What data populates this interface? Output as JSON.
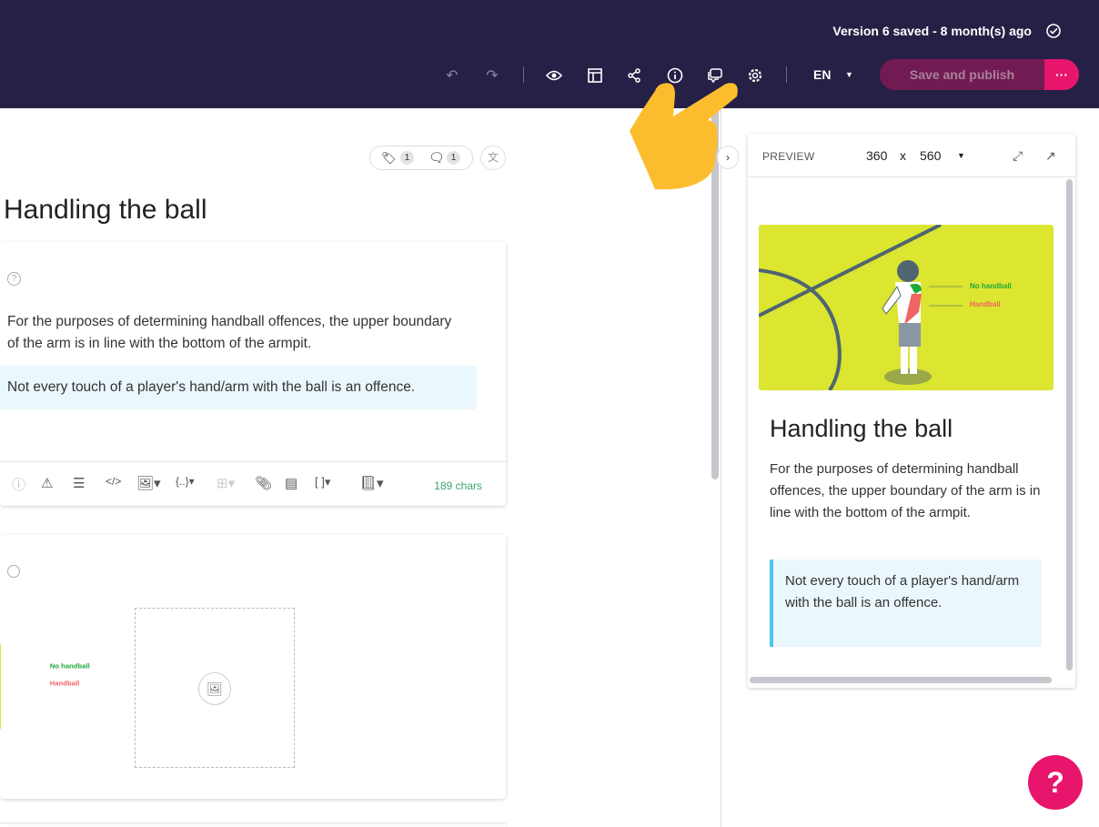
{
  "topbar": {
    "version_status": "Version 6 saved - 8 month(s) ago",
    "language": "EN",
    "publish_label": "Save and publish",
    "more_label": "···"
  },
  "editor": {
    "tag_count": "1",
    "comment_count": "1",
    "title": "Handling the ball",
    "text_line1": "For the purposes of determining handball offences, the upper boundary of the",
    "text_line2": "arm is in line with the bottom of the armpit.",
    "callout": "Not every touch of a player's hand/arm with the ball is an offence.",
    "char_count": "189 chars",
    "image_label_no": "No handball",
    "image_label_yes": "Handball"
  },
  "preview": {
    "label": "PREVIEW",
    "width": "360",
    "x": "x",
    "height": "560",
    "title": "Handling the ball",
    "paragraph": "For the purposes of determining handball offences, the upper boundary of the arm is in line with the bottom of the armpit.",
    "callout": "Not every touch of a player's hand/arm with the ball is an offence."
  },
  "help_label": "?",
  "colors": {
    "topbar": "#262046",
    "accent": "#e8156d",
    "publish": "#721b53",
    "callout": "#eaf7fc",
    "image_bg": "#dce52f"
  }
}
